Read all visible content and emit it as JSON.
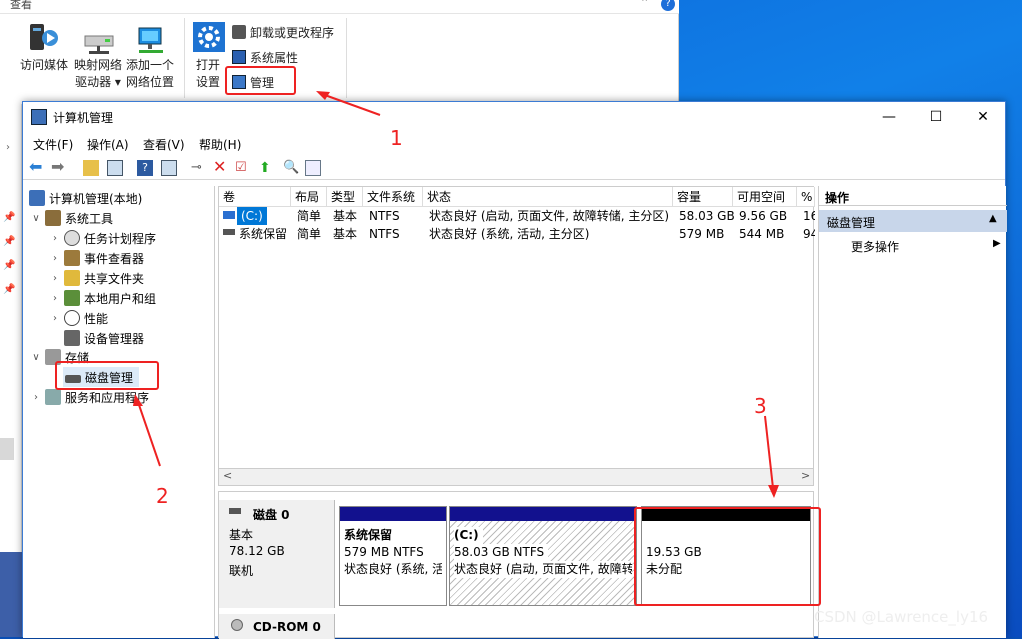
{
  "explorer": {
    "tab_hint": "查看",
    "items": [
      {
        "label": "访问媒体",
        "icon": "media-server-icon"
      },
      {
        "label": "映射网络\n驱动器 ▾",
        "icon": "map-network-drive-icon"
      },
      {
        "label": "添加一个\n网络位置",
        "icon": "add-network-location-icon"
      },
      {
        "label": "打开\n设置",
        "icon": "settings-gear-icon"
      }
    ],
    "small_items": [
      {
        "label": "卸载或更改程序",
        "icon": "uninstall-icon"
      },
      {
        "label": "系统属性",
        "icon": "system-properties-icon"
      },
      {
        "label": "管理",
        "icon": "computer-management-icon"
      }
    ]
  },
  "window": {
    "title": "计算机管理",
    "controls": {
      "minimize": "—",
      "maximize": "☐",
      "close": "✕"
    }
  },
  "menu": [
    "文件(F)",
    "操作(A)",
    "查看(V)",
    "帮助(H)"
  ],
  "tree": {
    "root": "计算机管理(本地)",
    "system_tools": "系统工具",
    "children": [
      "任务计划程序",
      "事件查看器",
      "共享文件夹",
      "本地用户和组",
      "性能",
      "设备管理器"
    ],
    "storage": "存储",
    "disk_mgmt": "磁盘管理",
    "services": "服务和应用程序"
  },
  "volume_list": {
    "columns": [
      "卷",
      "布局",
      "类型",
      "文件系统",
      "状态",
      "容量",
      "可用空间",
      "%"
    ],
    "rows": [
      [
        "(C:)",
        "简单",
        "基本",
        "NTFS",
        "状态良好 (启动, 页面文件, 故障转储, 主分区)",
        "58.03 GB",
        "9.56 GB",
        "16"
      ],
      [
        "系统保留",
        "简单",
        "基本",
        "NTFS",
        "状态良好 (系统, 活动, 主分区)",
        "579 MB",
        "544 MB",
        "94"
      ]
    ],
    "scroll_left": "<",
    "scroll_right": ">"
  },
  "disks": {
    "disk0": {
      "name": "磁盘 0",
      "type": "基本",
      "size": "78.12 GB",
      "status": "联机"
    },
    "cdrom": {
      "name": "CD-ROM 0"
    },
    "partitions": [
      {
        "name": "系统保留",
        "detail": "579 MB NTFS",
        "status": "状态良好 (系统, 活"
      },
      {
        "name": "(C:)",
        "detail": "58.03 GB NTFS",
        "status": "状态良好 (启动, 页面文件, 故障转"
      },
      {
        "name": "",
        "detail": "19.53 GB",
        "status": "未分配"
      }
    ]
  },
  "actions": {
    "header": "操作",
    "section": "磁盘管理",
    "more": "更多操作"
  },
  "annotations": {
    "n1": "1",
    "n2": "2",
    "n3": "3"
  },
  "watermark": "CSDN @Lawrence_ly16",
  "colors": {
    "accent_red": "#ee2222",
    "partition_header": "#12118e",
    "selected_blue": "#0078d7"
  }
}
